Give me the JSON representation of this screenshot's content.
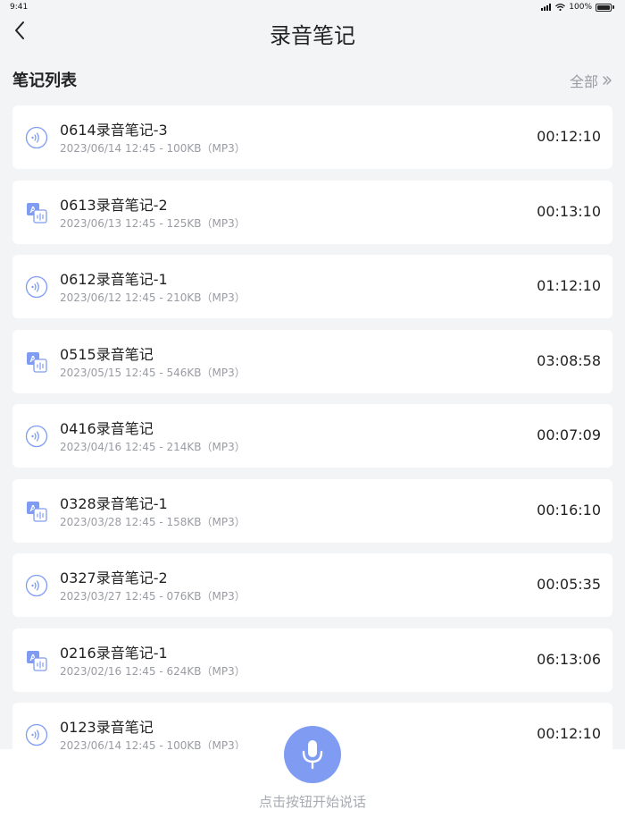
{
  "status_bar": {
    "time": "9:41",
    "battery": "100%"
  },
  "header": {
    "title": "录音笔记"
  },
  "section": {
    "title": "笔记列表",
    "all_label": "全部"
  },
  "notes": [
    {
      "title": "0614录音笔记-3",
      "meta": "2023/06/14  12:45 - 100KB（MP3）",
      "duration": "00:12:10",
      "icon": "audio-wave-icon"
    },
    {
      "title": "0613录音笔记-2",
      "meta": "2023/06/13  12:45 - 125KB（MP3）",
      "duration": "00:13:10",
      "icon": "transcribe-icon"
    },
    {
      "title": "0612录音笔记-1",
      "meta": "2023/06/12  12:45 - 210KB（MP3）",
      "duration": "01:12:10",
      "icon": "audio-wave-icon"
    },
    {
      "title": "0515录音笔记",
      "meta": "2023/05/15  12:45 - 546KB（MP3）",
      "duration": "03:08:58",
      "icon": "transcribe-icon"
    },
    {
      "title": "0416录音笔记",
      "meta": "2023/04/16  12:45 - 214KB（MP3）",
      "duration": "00:07:09",
      "icon": "audio-wave-icon"
    },
    {
      "title": "0328录音笔记-1",
      "meta": "2023/03/28  12:45 - 158KB（MP3）",
      "duration": "00:16:10",
      "icon": "transcribe-icon"
    },
    {
      "title": "0327录音笔记-2",
      "meta": "2023/03/27  12:45 - 076KB（MP3）",
      "duration": "00:05:35",
      "icon": "audio-wave-icon"
    },
    {
      "title": "0216录音笔记-1",
      "meta": "2023/02/16  12:45 - 624KB（MP3）",
      "duration": "06:13:06",
      "icon": "transcribe-icon"
    },
    {
      "title": "0123录音笔记",
      "meta": "2023/06/14  12:45 - 100KB（MP3）",
      "duration": "00:12:10",
      "icon": "audio-wave-icon"
    }
  ],
  "bottom": {
    "hint": "点击按钮开始说话"
  },
  "colors": {
    "accent": "#7f9cf2",
    "background": "#f3f4f6",
    "muted_text": "#9a9ca3"
  }
}
